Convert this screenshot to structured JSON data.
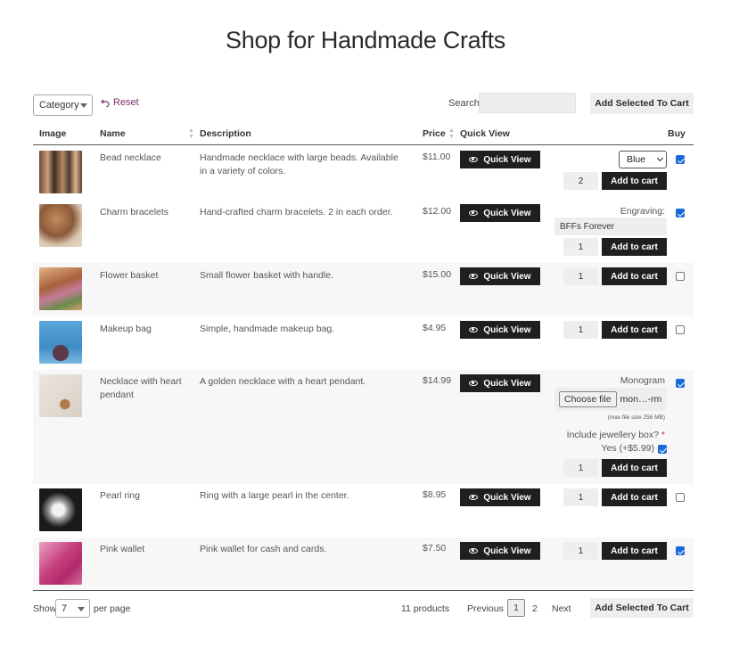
{
  "page": {
    "title": "Shop for Handmade Crafts"
  },
  "toolbar": {
    "category_select": "Category",
    "reset_label": "Reset",
    "search_label": "Search:",
    "search_value": "",
    "add_selected_label": "Add Selected To Cart"
  },
  "table": {
    "headers": {
      "image": "Image",
      "name": "Name",
      "description": "Description",
      "price": "Price",
      "quick_view": "Quick View",
      "buy": "Buy"
    },
    "quick_view_label": "Quick View",
    "add_to_cart_label": "Add to cart",
    "rows": [
      {
        "name": "Bead necklace",
        "description": "Handmade necklace with large beads. Available in a variety of colors.",
        "price": "$11.00",
        "qty": "2",
        "variant": "Blue",
        "checked": true
      },
      {
        "name": "Charm bracelets",
        "description": "Hand-crafted charm bracelets. 2 in each order.",
        "price": "$12.00",
        "qty": "1",
        "engraving_label": "Engraving:",
        "engraving_value": "BFFs Forever",
        "checked": true
      },
      {
        "name": "Flower basket",
        "description": "Small flower basket with handle.",
        "price": "$15.00",
        "qty": "1",
        "checked": false
      },
      {
        "name": "Makeup bag",
        "description": "Simple, handmade makeup bag.",
        "price": "$4.95",
        "qty": "1",
        "checked": false
      },
      {
        "name": "Necklace with heart pendant",
        "description": "A golden necklace with a heart pendant.",
        "price": "$14.99",
        "qty": "1",
        "monogram_label": "Monogram",
        "choose_file_label": "Choose file",
        "file_name": "mon…-rm",
        "max_file_note": "(max file size 256 MB)",
        "jewellery_label": "Include jewellery box?",
        "required_mark": "*",
        "jewellery_option": "Yes (+$5.99)",
        "checked": true
      },
      {
        "name": "Pearl ring",
        "description": "Ring with a large pearl in the center.",
        "price": "$8.95",
        "qty": "1",
        "checked": false
      },
      {
        "name": "Pink wallet",
        "description": "Pink wallet for cash and cards.",
        "price": "$7.50",
        "qty": "1",
        "checked": true
      }
    ]
  },
  "footer": {
    "show_label": "Show",
    "per_page_value": "7",
    "per_page_label": "per page",
    "count": "11 products",
    "previous": "Previous",
    "pages": [
      "1",
      "2"
    ],
    "next": "Next",
    "add_selected_label": "Add Selected To Cart"
  },
  "colors": {
    "dark_button": "#1f1f1f",
    "reset_link": "#7a2e6b",
    "checkbox": "#1a6bd8",
    "light_field": "#eeeeee"
  },
  "icons": {
    "reset": "undo-arrow-icon",
    "sort": "sort-arrows-icon",
    "quick_view": "eye-icon",
    "dropdown": "chevron-down-icon"
  }
}
